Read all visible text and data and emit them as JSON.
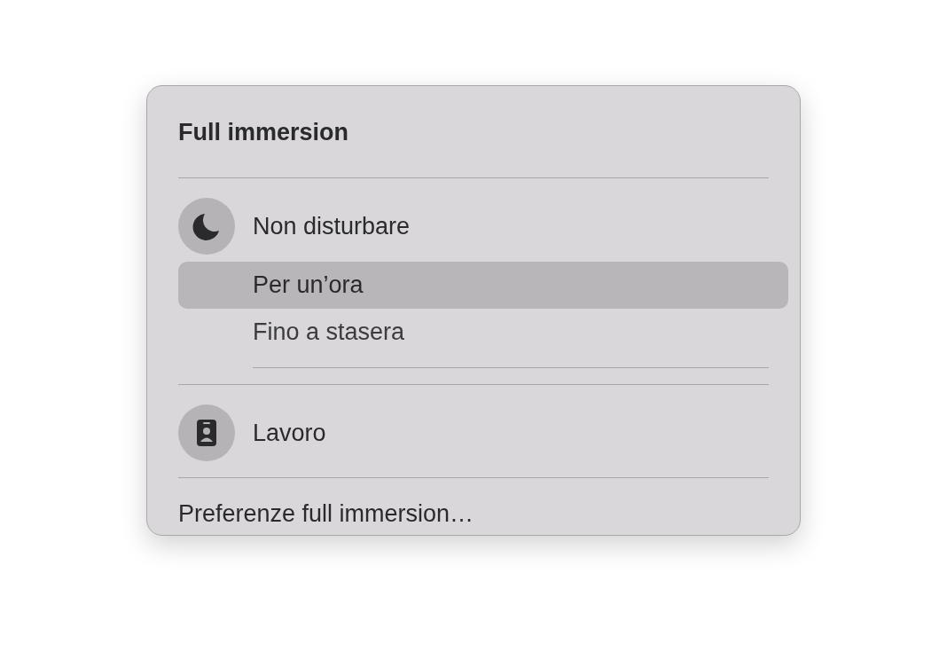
{
  "title": "Full immersion",
  "focus_modes": [
    {
      "kind": "moon",
      "label": "Non disturbare",
      "options": [
        {
          "label": "Per un’ora",
          "selected": true
        },
        {
          "label": "Fino a stasera",
          "selected": false
        }
      ]
    },
    {
      "kind": "badge",
      "label": "Lavoro"
    }
  ],
  "preferences": "Preferenze full immersion…"
}
